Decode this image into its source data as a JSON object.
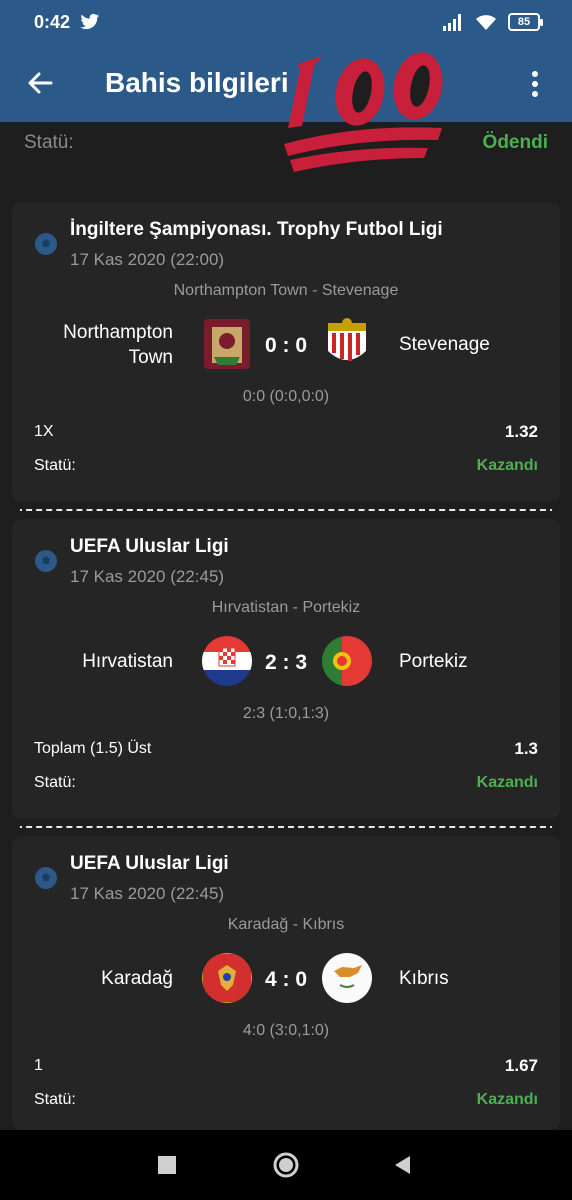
{
  "status_bar": {
    "time": "0:42",
    "battery": "85"
  },
  "header": {
    "title": "Bahis bilgileri"
  },
  "bet_status": {
    "label": "Statü:",
    "value": "Ödendi"
  },
  "colors": {
    "header_bg": "#2b5a8a",
    "win_green": "#4caf50",
    "card_bg": "#252525"
  },
  "bets": [
    {
      "league": "İngiltere Şampiyonası. Trophy Futbol Ligi",
      "date": "17 Kas 2020 (22:00)",
      "match": "Northampton Town - Stevenage",
      "home": "Northampton\nTown",
      "away": "Stevenage",
      "score": "0 : 0",
      "detail": "0:0 (0:0,0:0)",
      "pick": "1X",
      "odds": "1.32",
      "status_label": "Statü:",
      "status_value": "Kazandı"
    },
    {
      "league": "UEFA Uluslar Ligi",
      "date": "17 Kas 2020 (22:45)",
      "match": "Hırvatistan - Portekiz",
      "home": "Hırvatistan",
      "away": "Portekiz",
      "score": "2 : 3",
      "detail": "2:3 (1:0,1:3)",
      "pick": "Toplam (1.5) Üst",
      "odds": "1.3",
      "status_label": "Statü:",
      "status_value": "Kazandı"
    },
    {
      "league": "UEFA Uluslar Ligi",
      "date": "17 Kas 2020 (22:45)",
      "match": "Karadağ - Kıbrıs",
      "home": "Karadağ",
      "away": "Kıbrıs",
      "score": "4 : 0",
      "detail": "4:0 (3:0,1:0)",
      "pick": "1",
      "odds": "1.67",
      "status_label": "Statü:",
      "status_value": "Kazandı"
    }
  ]
}
